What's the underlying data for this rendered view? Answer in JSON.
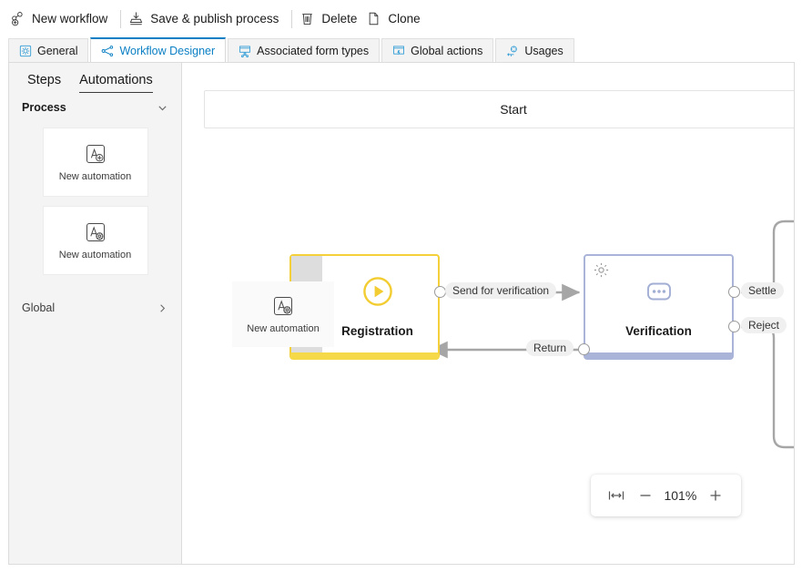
{
  "toolbar": {
    "items": [
      {
        "label": "New workflow",
        "icon": "new-workflow-icon"
      },
      {
        "label": "Save & publish process",
        "icon": "save-publish-icon"
      },
      {
        "label": "Delete",
        "icon": "trash-icon"
      },
      {
        "label": "Clone",
        "icon": "clone-icon"
      }
    ]
  },
  "tabs": [
    {
      "label": "General",
      "icon": "gear-square-icon",
      "active": false
    },
    {
      "label": "Workflow Designer",
      "icon": "workflow-branch-icon",
      "active": true
    },
    {
      "label": "Associated form types",
      "icon": "form-types-icon",
      "active": false
    },
    {
      "label": "Global actions",
      "icon": "global-actions-icon",
      "active": false
    },
    {
      "label": "Usages",
      "icon": "usages-icon",
      "active": false
    }
  ],
  "sidebar": {
    "tabs": [
      {
        "label": "Steps",
        "active": false
      },
      {
        "label": "Automations",
        "active": true
      }
    ],
    "process_section": {
      "title": "Process",
      "chevron": "chevron-down-icon",
      "cards": [
        {
          "label": "New automation",
          "icon": "automation-add-icon"
        },
        {
          "label": "New automation",
          "icon": "automation-gear-icon"
        }
      ]
    },
    "global_section": {
      "title": "Global",
      "chevron": "chevron-right-icon"
    }
  },
  "canvas": {
    "start_label": "Start",
    "dragged_card": {
      "label": "New automation",
      "icon": "automation-gear-icon"
    },
    "nodes": [
      {
        "id": "registration",
        "title": "Registration",
        "icon": "play-circle-icon",
        "accent": "#f5d948",
        "border": "#f4d03a"
      },
      {
        "id": "verification",
        "title": "Verification",
        "icon": "ellipsis-rounded-icon",
        "corner_icon": "gear-icon",
        "accent": "#aab4d8",
        "border": "#aab4d8"
      }
    ],
    "edges": [
      {
        "label": "Send for verification",
        "from": "registration",
        "to": "verification"
      },
      {
        "label": "Return",
        "from": "verification",
        "to": "registration"
      },
      {
        "label": "Settle",
        "from": "verification",
        "to": "offscreen"
      },
      {
        "label": "Reject",
        "from": "verification",
        "to": "offscreen"
      }
    ],
    "zoom_control": {
      "fit_icon": "fit-width-icon",
      "zoom_out_label": "−",
      "value": "101%",
      "zoom_in_label": "+"
    }
  },
  "colors": {
    "accent_blue": "#0a7fc4",
    "registration_yellow": "#f5d948",
    "verification_blue": "#aab4d8",
    "sidebar_bg": "#f4f4f4",
    "edge_gray": "#a6a6a6"
  }
}
